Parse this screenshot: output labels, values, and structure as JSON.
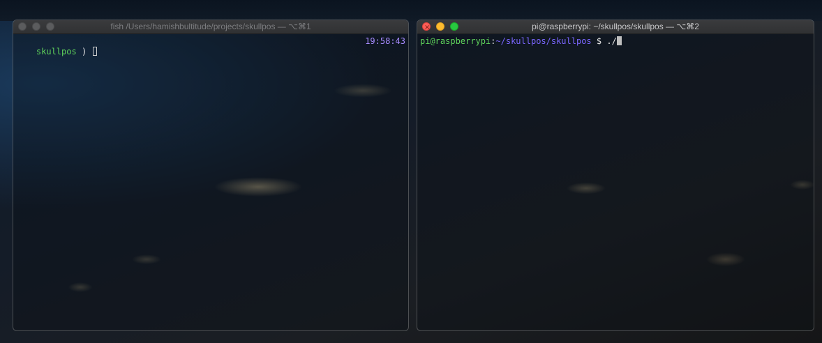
{
  "windows": {
    "left": {
      "title": "fish /Users/hamishbultitude/projects/skullpos — ⌥⌘1",
      "prompt_dir": "skullpos",
      "prompt_symbol": ")",
      "clock": "19:58:43"
    },
    "right": {
      "title": "pi@raspberrypi: ~/skullpos/skullpos — ⌥⌘2",
      "prompt_user_host": "pi@raspberrypi",
      "prompt_colon": ":",
      "prompt_path": "~/skullpos/skullpos",
      "prompt_symbol": "$",
      "command": "./"
    }
  },
  "colors": {
    "prompt_green": "#5fd35b",
    "path_purple": "#7b66ff",
    "clock_violet": "#a78bff",
    "close_red": "#fd5e57",
    "minimize_yellow": "#febc2e",
    "zoom_green": "#28c840"
  },
  "icons": {
    "close": "close-icon",
    "minimize": "minimize-icon",
    "zoom": "zoom-icon"
  }
}
